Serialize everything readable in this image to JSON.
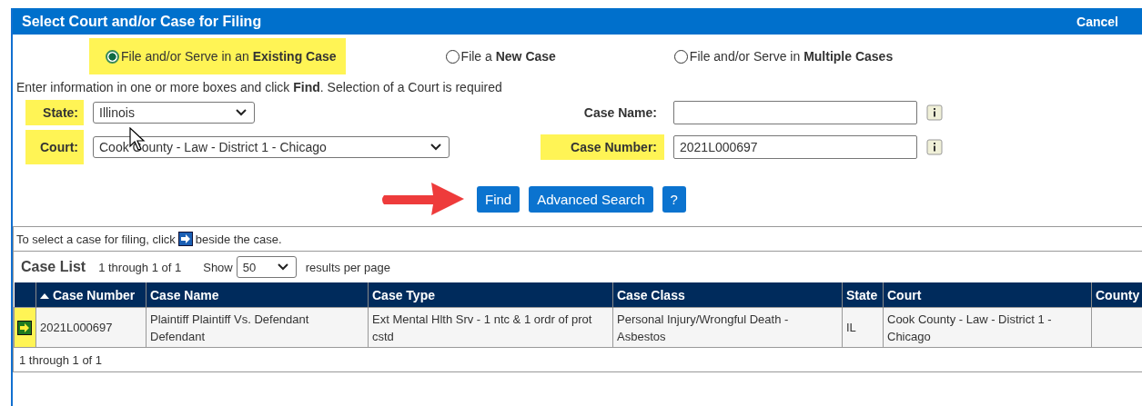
{
  "window": {
    "title": "Select Court and/or Case for Filing",
    "cancel": "Cancel"
  },
  "filing_options": [
    {
      "parts": [
        "File and/or Serve in an ",
        "Existing Case"
      ],
      "selected": true,
      "highlighted": true
    },
    {
      "parts": [
        "File a ",
        "New Case"
      ],
      "selected": false,
      "highlighted": false
    },
    {
      "parts": [
        "File and/or Serve in ",
        "Multiple Cases"
      ],
      "selected": false,
      "highlighted": false
    }
  ],
  "instructions": "Enter information in one or more boxes and click **Find**. Selection of a Court is required",
  "fields": {
    "state": {
      "label": "State:",
      "value": "Illinois",
      "highlighted": true
    },
    "court": {
      "label": "Court:",
      "value": "Cook County - Law - District 1 - Chicago",
      "highlighted": true
    },
    "case_name": {
      "label": "Case Name:",
      "highlighted": false
    },
    "case_number": {
      "label": "Case Number:",
      "value": "2021L000697",
      "highlighted": true
    }
  },
  "buttons": {
    "find": "Find",
    "advanced": "Advanced Search",
    "help": "?"
  },
  "results": {
    "hint_before": "To select a case for filing, click",
    "hint_after": "beside the case.",
    "title": "Case List",
    "range": "1 through 1 of 1",
    "show": "Show",
    "per_page": "50",
    "per_page_suffix": "results per page",
    "columns": [
      {
        "sorted": false
      },
      {
        "label": "Case Number",
        "sorted": true
      },
      {
        "label": "Case Name",
        "sorted": false
      },
      {
        "label": "Case Type",
        "sorted": false
      },
      {
        "label": "Case Class",
        "sorted": false
      },
      {
        "label": "State",
        "sorted": false
      },
      {
        "label": "Court",
        "sorted": false
      },
      {
        "label": "County",
        "sorted": false
      }
    ],
    "rows": [
      {
        "highlighted": true,
        "cells": [
          null,
          "2021L000697",
          "Plaintiff Plaintiff Vs. Defendant Defendant",
          "Ext Mental Hlth Srv - 1 ntc & 1 ordr of prot cstd",
          "Personal Injury/Wrongful Death - Asbestos",
          "IL",
          "Cook County - Law - District 1 - Chicago",
          null
        ]
      }
    ],
    "footer": "1 through 1 of 1"
  }
}
